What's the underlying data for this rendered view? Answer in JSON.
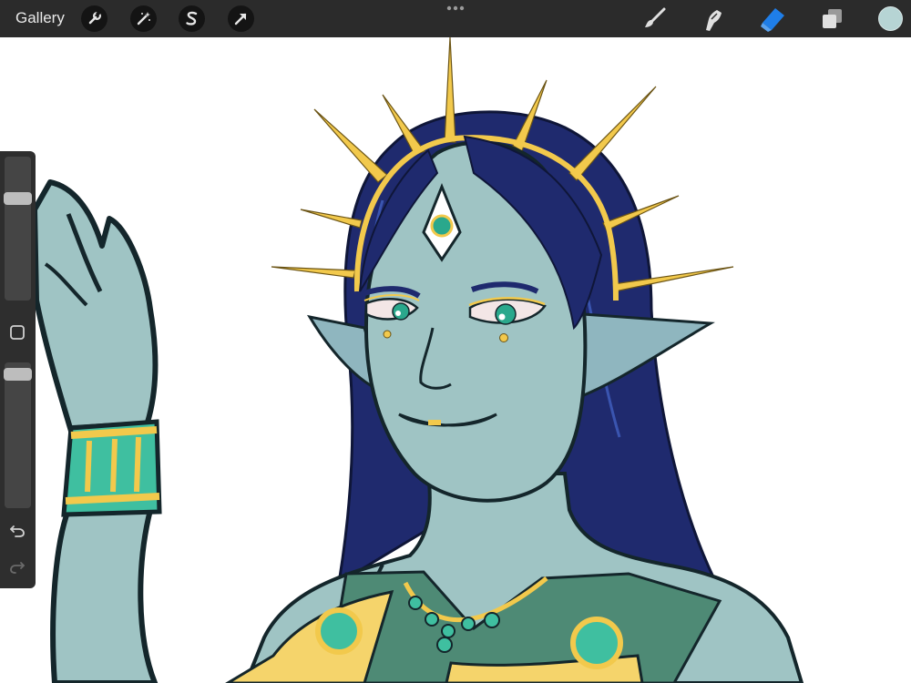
{
  "app": {
    "gallery_label": "Gallery"
  },
  "top_toolbar": {
    "left_tools": [
      "wrench-icon",
      "magic-wand-icon",
      "selection-s-icon",
      "transform-arrow-icon"
    ],
    "right_tools": [
      "brush-icon",
      "smudge-icon",
      "eraser-icon",
      "layers-icon"
    ],
    "active_tool": "eraser",
    "active_color": "#b6d4d4",
    "accent_color": "#1f7ee8"
  },
  "sidebar": {
    "brush_size": 0.27,
    "opacity": 0.04
  }
}
